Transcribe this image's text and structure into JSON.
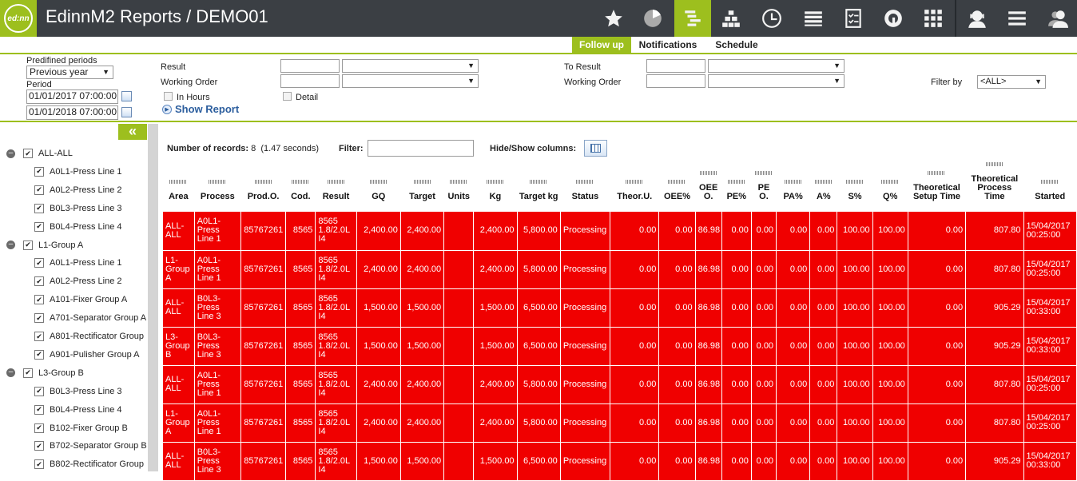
{
  "app": {
    "title": "EdinnM2 Reports / DEMO01",
    "logo_text": "ed:nn"
  },
  "nav_icons": [
    "star-icon",
    "pie-chart-icon",
    "gantt-icon",
    "pyramid-icon",
    "clock-icon",
    "stack-icon",
    "checklist-icon",
    "q-icon",
    "grid-icon",
    "user-support-icon",
    "menu-icon",
    "users-icon"
  ],
  "subnav": {
    "follow_up": "Follow up",
    "notifications": "Notifications",
    "schedule": "Schedule"
  },
  "filters": {
    "predefined_label": "Predifined periods",
    "predefined_value": "Previous year",
    "period_label": "Period",
    "period_from": "01/01/2017 07:00:00",
    "period_to": "01/01/2018 07:00:00",
    "result_label": "Result",
    "working_order_label": "Working Order",
    "in_hours_label": "In Hours",
    "detail_label": "Detail",
    "show_report": "Show Report",
    "to_result_label": "To Result",
    "to_working_order_label": "Working Order",
    "filter_by_label": "Filter by",
    "filter_by_value": "<ALL>"
  },
  "tree": [
    {
      "label": "ALL-ALL",
      "level": 0,
      "group": true
    },
    {
      "label": "A0L1-Press Line 1",
      "level": 1
    },
    {
      "label": "A0L2-Press Line 2",
      "level": 1
    },
    {
      "label": "B0L3-Press Line 3",
      "level": 1
    },
    {
      "label": "B0L4-Press Line 4",
      "level": 1
    },
    {
      "label": "L1-Group A",
      "level": 0,
      "group": true
    },
    {
      "label": "A0L1-Press Line 1",
      "level": 1
    },
    {
      "label": "A0L2-Press Line 2",
      "level": 1
    },
    {
      "label": "A101-Fixer Group A",
      "level": 1
    },
    {
      "label": "A701-Separator Group A",
      "level": 1
    },
    {
      "label": "A801-Rectificator Group",
      "level": 1
    },
    {
      "label": "A901-Pulisher Group A",
      "level": 1
    },
    {
      "label": "L3-Group B",
      "level": 0,
      "group": true
    },
    {
      "label": "B0L3-Press Line 3",
      "level": 1
    },
    {
      "label": "B0L4-Press Line 4",
      "level": 1
    },
    {
      "label": "B102-Fixer Group B",
      "level": 1
    },
    {
      "label": "B702-Separator Group B",
      "level": 1
    },
    {
      "label": "B802-Rectificator Group",
      "level": 1
    }
  ],
  "toolbar": {
    "records_label": "Number of records:",
    "records_value": "8",
    "records_time": "(1.47 seconds)",
    "filter_label": "Filter:",
    "hide_show_label": "Hide/Show columns:"
  },
  "table": {
    "columns": [
      "Area",
      "Process",
      "Prod.O.",
      "Cod.",
      "Result",
      "GQ",
      "Target",
      "Units",
      "Kg",
      "Target kg",
      "Status",
      "Theor.U.",
      "OEE%",
      "OEE O.",
      "PE%",
      "PE O.",
      "PA%",
      "A%",
      "S%",
      "Q%",
      "Theoretical Setup Time",
      "Theoretical Process Time",
      "Started"
    ],
    "rows": [
      [
        "ALL-ALL",
        "A0L1-Press Line 1",
        "85767261",
        "8565",
        "8565 1.8/2.0L I4",
        "2,400.00",
        "2,400.00",
        "",
        "2,400.00",
        "5,800.00",
        "Processing",
        "0.00",
        "0.00",
        "86.98",
        "0.00",
        "0.00",
        "0.00",
        "0.00",
        "100.00",
        "100.00",
        "0.00",
        "807.80",
        "15/04/2017 00:25:00"
      ],
      [
        "L1-Group A",
        "A0L1-Press Line 1",
        "85767261",
        "8565",
        "8565 1.8/2.0L I4",
        "2,400.00",
        "2,400.00",
        "",
        "2,400.00",
        "5,800.00",
        "Processing",
        "0.00",
        "0.00",
        "86.98",
        "0.00",
        "0.00",
        "0.00",
        "0.00",
        "100.00",
        "100.00",
        "0.00",
        "807.80",
        "15/04/2017 00:25:00"
      ],
      [
        "ALL-ALL",
        "B0L3-Press Line 3",
        "85767261",
        "8565",
        "8565 1.8/2.0L I4",
        "1,500.00",
        "1,500.00",
        "",
        "1,500.00",
        "6,500.00",
        "Processing",
        "0.00",
        "0.00",
        "86.98",
        "0.00",
        "0.00",
        "0.00",
        "0.00",
        "100.00",
        "100.00",
        "0.00",
        "905.29",
        "15/04/2017 00:33:00"
      ],
      [
        "L3-Group B",
        "B0L3-Press Line 3",
        "85767261",
        "8565",
        "8565 1.8/2.0L I4",
        "1,500.00",
        "1,500.00",
        "",
        "1,500.00",
        "6,500.00",
        "Processing",
        "0.00",
        "0.00",
        "86.98",
        "0.00",
        "0.00",
        "0.00",
        "0.00",
        "100.00",
        "100.00",
        "0.00",
        "905.29",
        "15/04/2017 00:33:00"
      ],
      [
        "ALL-ALL",
        "A0L1-Press Line 1",
        "85767261",
        "8565",
        "8565 1.8/2.0L I4",
        "2,400.00",
        "2,400.00",
        "",
        "2,400.00",
        "5,800.00",
        "Processing",
        "0.00",
        "0.00",
        "86.98",
        "0.00",
        "0.00",
        "0.00",
        "0.00",
        "100.00",
        "100.00",
        "0.00",
        "807.80",
        "15/04/2017 00:25:00"
      ],
      [
        "L1-Group A",
        "A0L1-Press Line 1",
        "85767261",
        "8565",
        "8565 1.8/2.0L I4",
        "2,400.00",
        "2,400.00",
        "",
        "2,400.00",
        "5,800.00",
        "Processing",
        "0.00",
        "0.00",
        "86.98",
        "0.00",
        "0.00",
        "0.00",
        "0.00",
        "100.00",
        "100.00",
        "0.00",
        "807.80",
        "15/04/2017 00:25:00"
      ],
      [
        "ALL-ALL",
        "B0L3-Press Line 3",
        "85767261",
        "8565",
        "8565 1.8/2.0L I4",
        "1,500.00",
        "1,500.00",
        "",
        "1,500.00",
        "6,500.00",
        "Processing",
        "0.00",
        "0.00",
        "86.98",
        "0.00",
        "0.00",
        "0.00",
        "0.00",
        "100.00",
        "100.00",
        "0.00",
        "905.29",
        "15/04/2017 00:33:00"
      ]
    ]
  }
}
